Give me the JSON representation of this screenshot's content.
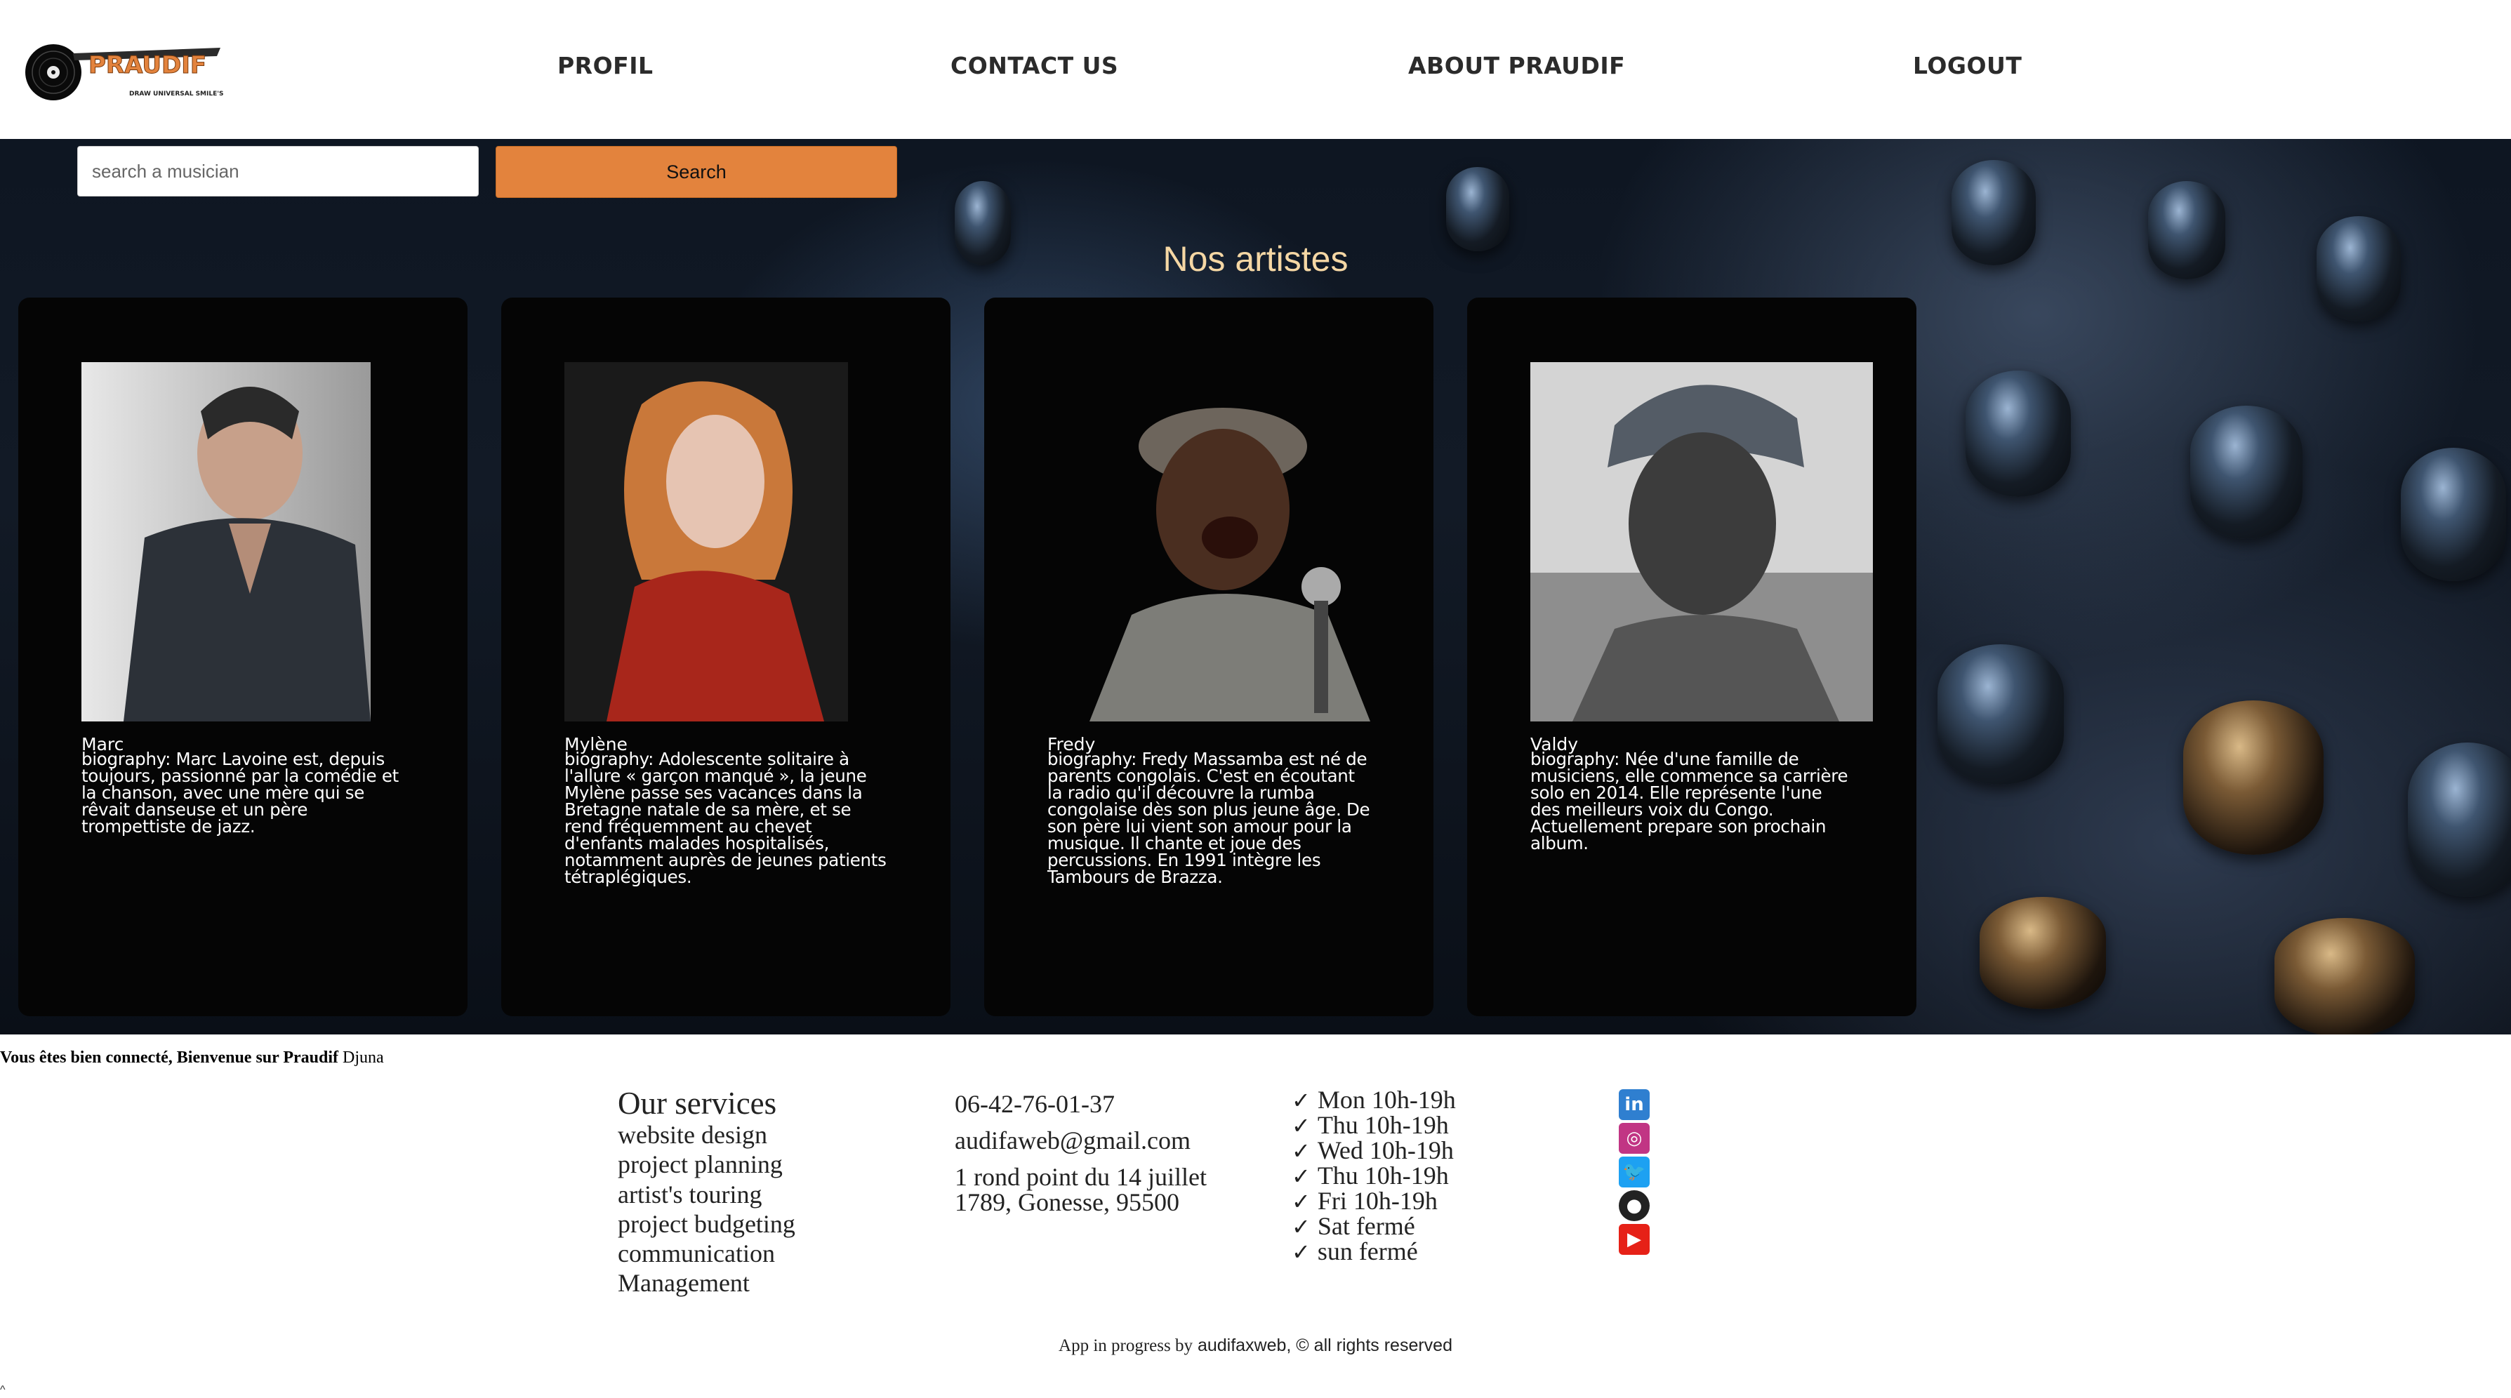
{
  "header": {
    "logo": {
      "text": "PRAUDIF",
      "tagline": "DRAW UNIVERSAL SMILE'S"
    },
    "nav": [
      {
        "label": "PROFIL"
      },
      {
        "label": "CONTACT US"
      },
      {
        "label": "ABOUT PRAUDIF"
      },
      {
        "label": "LOGOUT"
      }
    ]
  },
  "search": {
    "placeholder": "search a musician",
    "value": "",
    "button_label": "Search"
  },
  "artists_section": {
    "title": "Nos artistes",
    "artists": [
      {
        "name": "Marc",
        "bio": "biography: Marc Lavoine est, depuis toujours, passionné par la comédie et la chanson, avec une mère qui se rêvait danseuse et un père trompettiste de jazz."
      },
      {
        "name": "Mylène",
        "bio": "biography: Adolescente solitaire à l'allure « garçon manqué », la jeune Mylène passe ses vacances dans la Bretagne natale de sa mère, et se rend fréquemment au chevet d'enfants malades hospitalisés, notamment auprès de jeunes patients tétraplégiques."
      },
      {
        "name": "Fredy",
        "bio": "biography: Fredy Massamba est né de parents congolais. C'est en écoutant la radio qu'il découvre la rumba congolaise dès son plus jeune âge. De son père lui vient son amour pour la musique. Il chante et joue des percussions. En 1991 intègre les Tambours de Brazza."
      },
      {
        "name": "Valdy",
        "bio": "biography: Née d'une famille de musiciens, elle commence sa carrière solo en 2014. Elle représente l'une des meilleurs voix du Congo. Actuellement prepare son prochain album."
      }
    ]
  },
  "welcome": {
    "message": "Vous êtes bien connecté, Bienvenue sur Praudif",
    "username": "Djuna"
  },
  "footer": {
    "services": {
      "title": "Our services",
      "items": [
        "website design",
        "project planning",
        "artist's touring",
        "project budgeting",
        "communication",
        "Management"
      ]
    },
    "contact": {
      "phone": "06-42-76-01-37",
      "email": "audifaweb@gmail.com",
      "address_line1": "1 rond point du 14 juillet",
      "address_line2": "1789, Gonesse, 95500"
    },
    "hours": [
      {
        "check": "✓",
        "text": "Mon 10h-19h"
      },
      {
        "check": "✓",
        "text": "Thu 10h-19h"
      },
      {
        "check": "✓",
        "text": "Wed 10h-19h"
      },
      {
        "check": "✓",
        "text": "Thu 10h-19h"
      },
      {
        "check": "✓",
        "text": "Fri 10h-19h"
      },
      {
        "check": "✓",
        "text": "Sat fermé"
      },
      {
        "check": "✓",
        "text": "sun fermé"
      }
    ],
    "social": [
      {
        "icon": "linkedin-icon",
        "glyph": "in",
        "color": "#2f7fd0"
      },
      {
        "icon": "instagram-icon",
        "glyph": "◎",
        "color": "#c13584"
      },
      {
        "icon": "twitter-icon",
        "glyph": "🐦",
        "color": "#1da1f2"
      },
      {
        "icon": "github-icon",
        "glyph": "●",
        "color": "#222222"
      },
      {
        "icon": "youtube-icon",
        "glyph": "▶",
        "color": "#e62117"
      }
    ],
    "copyright_prefix": "App in progress by",
    "copyright_suffix": "audifaxweb, © all rights reserved"
  },
  "colors": {
    "accent": "#e3833d",
    "section_title": "#f5d7a4",
    "card_bg": "#050505"
  }
}
